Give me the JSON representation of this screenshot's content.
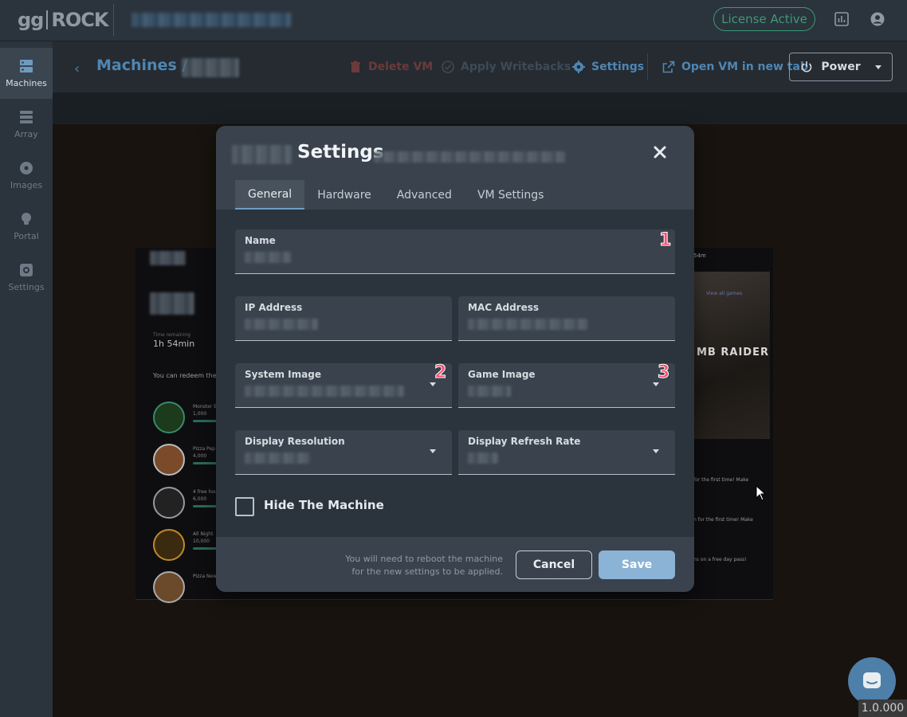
{
  "brand": {
    "logo_left": "gg",
    "logo_right": "ROCK"
  },
  "topbar": {
    "license_label": "License Active",
    "stats_icon": "bar-chart-icon",
    "account_icon": "account-circle-icon"
  },
  "sidebar": {
    "items": [
      {
        "label": "Machines",
        "icon": "server-icon",
        "active": true
      },
      {
        "label": "Array",
        "icon": "storage-icon",
        "active": false
      },
      {
        "label": "Images",
        "icon": "disc-icon",
        "active": false
      },
      {
        "label": "Portal",
        "icon": "lightbulb-icon",
        "active": false
      },
      {
        "label": "Settings",
        "icon": "gear-icon",
        "active": false
      }
    ]
  },
  "header": {
    "breadcrumb_root": "Machines /",
    "actions": {
      "delete": "Delete VM",
      "apply": "Apply Writebacks",
      "settings": "Settings",
      "open_tab": "Open VM in new tab"
    },
    "power_label": "Power"
  },
  "preview": {
    "time_label": "Time remaining",
    "time_value": "1h 54min",
    "redeem_text": "You can redeem thes",
    "rewards": [
      {
        "name": "Monster E",
        "points": "1,000"
      },
      {
        "name": "Pizza Pep",
        "points": "4,000"
      },
      {
        "name": "4 free hou",
        "points": "6,000"
      },
      {
        "name": "All Night",
        "points": "10,000"
      },
      {
        "name": "Pizza New",
        "points": ""
      }
    ],
    "top_right_time": "54m",
    "view_all": "View all games",
    "game_title": "MB RAIDER",
    "right_texts": [
      "for the first time! Make",
      "n for the first time! Make",
      "ns on a free day pass!"
    ]
  },
  "modal": {
    "title": "Settings",
    "close_icon": "close-icon",
    "tabs": [
      "General",
      "Hardware",
      "Advanced",
      "VM Settings"
    ],
    "active_tab": "General",
    "fields": {
      "name": {
        "label": "Name",
        "marker": "1"
      },
      "ip": {
        "label": "IP Address"
      },
      "mac": {
        "label": "MAC Address"
      },
      "system_image": {
        "label": "System Image",
        "marker": "2"
      },
      "game_image": {
        "label": "Game Image",
        "marker": "3"
      },
      "display_resolution": {
        "label": "Display Resolution"
      },
      "display_refresh_rate": {
        "label": "Display Refresh Rate"
      }
    },
    "hide_machine_label": "Hide The Machine",
    "hide_machine_checked": false,
    "footer_note_line1": "You will need to reboot the machine",
    "footer_note_line2": "for the new settings to be applied.",
    "cancel_label": "Cancel",
    "save_label": "Save"
  },
  "version": "1.0.000",
  "colors": {
    "accent": "#4f86b3",
    "license": "#3a9a77",
    "marker": "#ff4d6e",
    "save": "#8ab3d6"
  }
}
